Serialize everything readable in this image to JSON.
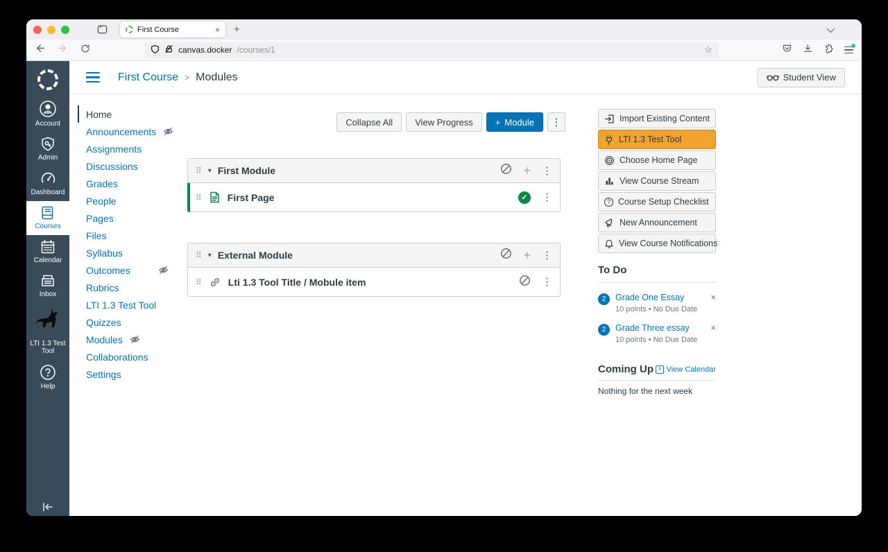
{
  "browser": {
    "tab_title": "First Course",
    "url_host": "canvas.docker",
    "url_path": "/courses/1"
  },
  "icons": {
    "drag": "⠿",
    "caret_down": "▾",
    "kebab": "⋮",
    "plus": "+",
    "close": "×",
    "star": "☆",
    "check": "✓",
    "question": "?",
    "breadcrumb_sep": ">"
  },
  "global_nav": {
    "items": [
      {
        "label": "Account"
      },
      {
        "label": "Admin"
      },
      {
        "label": "Dashboard"
      },
      {
        "label": "Courses"
      },
      {
        "label": "Calendar"
      },
      {
        "label": "Inbox"
      },
      {
        "label": "LTI 1.3 Test Tool"
      },
      {
        "label": "Help"
      }
    ]
  },
  "header": {
    "course": "First Course",
    "page": "Modules",
    "student_view": "Student View"
  },
  "course_nav": {
    "items": [
      {
        "label": "Home"
      },
      {
        "label": "Announcements",
        "hidden": true
      },
      {
        "label": "Assignments"
      },
      {
        "label": "Discussions"
      },
      {
        "label": "Grades"
      },
      {
        "label": "People"
      },
      {
        "label": "Pages"
      },
      {
        "label": "Files"
      },
      {
        "label": "Syllabus"
      },
      {
        "label": "Outcomes",
        "hidden": true
      },
      {
        "label": "Rubrics"
      },
      {
        "label": "LTI 1.3 Test Tool"
      },
      {
        "label": "Quizzes"
      },
      {
        "label": "Modules",
        "hidden": true
      },
      {
        "label": "Collaborations"
      },
      {
        "label": "Settings"
      }
    ]
  },
  "actions": {
    "collapse_all": "Collapse All",
    "view_progress": "View Progress",
    "add_module": "Module"
  },
  "modules": [
    {
      "title": "First Module",
      "items": [
        {
          "title": "First Page",
          "type": "page",
          "published": true
        }
      ]
    },
    {
      "title": "External Module",
      "items": [
        {
          "title": "Lti 1.3 Tool Title / Mobule item",
          "type": "external-link",
          "published": false
        }
      ]
    }
  ],
  "sidebar": {
    "buttons": [
      {
        "label": "Import Existing Content"
      },
      {
        "label": "LTI 1.3 Test Tool",
        "highlighted": true
      },
      {
        "label": "Choose Home Page"
      },
      {
        "label": "View Course Stream"
      },
      {
        "label": "Course Setup Checklist"
      },
      {
        "label": "New Announcement"
      },
      {
        "label": "View Course Notifications"
      }
    ],
    "todo": {
      "heading": "To Do",
      "items": [
        {
          "badge": "2",
          "title": "Grade One Essay",
          "meta": "10 points • No Due Date"
        },
        {
          "badge": "2",
          "title": "Grade Three essay",
          "meta": "10 points • No Due Date"
        }
      ]
    },
    "coming_up": {
      "heading": "Coming Up",
      "link": "View Calendar",
      "cal_day": "3",
      "empty": "Nothing for the next week"
    }
  },
  "colors": {
    "accent_blue": "#0374B5",
    "published_green": "#0B874B",
    "lti_orange": "#F0A32E",
    "nav_dark": "#394B58"
  }
}
